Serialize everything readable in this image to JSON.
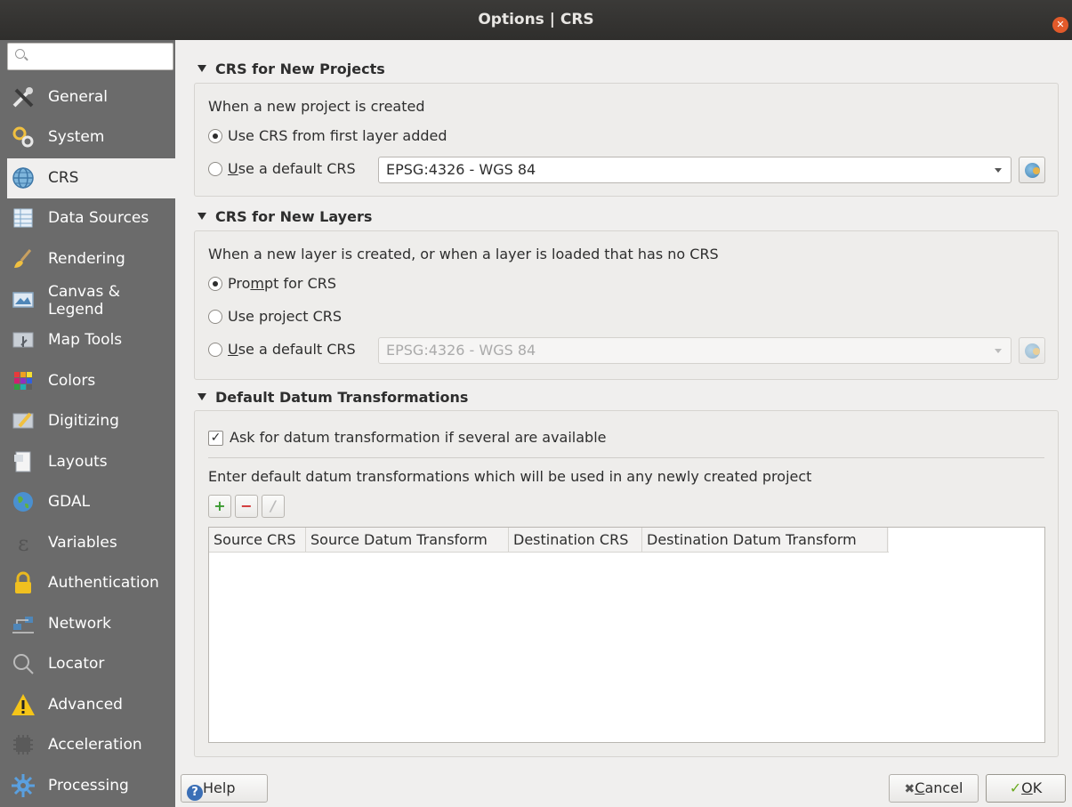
{
  "window": {
    "title": "Options | CRS",
    "close_glyph": "✕"
  },
  "sidebar": {
    "search_placeholder": "",
    "items": [
      {
        "label": "General",
        "icon": "tools-icon"
      },
      {
        "label": "System",
        "icon": "system-gears-icon"
      },
      {
        "label": "CRS",
        "icon": "globe-icon",
        "selected": true
      },
      {
        "label": "Data Sources",
        "icon": "table-icon"
      },
      {
        "label": "Rendering",
        "icon": "brush-icon"
      },
      {
        "label": "Canvas &",
        "label2": "Legend",
        "icon": "canvas-icon"
      },
      {
        "label": "Map Tools",
        "icon": "map-tools-icon"
      },
      {
        "label": "Colors",
        "icon": "colors-icon"
      },
      {
        "label": "Digitizing",
        "icon": "digitizing-icon"
      },
      {
        "label": "Layouts",
        "icon": "layouts-icon"
      },
      {
        "label": "GDAL",
        "icon": "gdal-globe-icon"
      },
      {
        "label": "Variables",
        "icon": "epsilon-icon"
      },
      {
        "label": "Authentication",
        "icon": "lock-icon"
      },
      {
        "label": "Network",
        "icon": "network-icon"
      },
      {
        "label": "Locator",
        "icon": "search-icon"
      },
      {
        "label": "Advanced",
        "icon": "warning-icon"
      },
      {
        "label": "Acceleration",
        "icon": "chip-icon"
      },
      {
        "label": "Processing",
        "icon": "processing-gear-icon"
      }
    ]
  },
  "projects": {
    "heading": "CRS for New Projects",
    "intro": "When a new project is created",
    "opt_first_layer": "Use CRS from first layer added",
    "opt_default_pre": "",
    "opt_default_u": "U",
    "opt_default_rest": "se a default CRS",
    "crs_value": "EPSG:4326 - WGS 84"
  },
  "layers": {
    "heading": "CRS for New Layers",
    "intro": "When a new layer is created, or when a layer is loaded that has no CRS",
    "opt_prompt_a": "Pro",
    "opt_prompt_u": "m",
    "opt_prompt_b": "pt for CRS",
    "opt_project": "Use project CRS",
    "opt_default_u": "U",
    "opt_default_rest": "se a default CRS",
    "crs_value": "EPSG:4326 - WGS 84"
  },
  "datum": {
    "heading": "Default Datum Transformations",
    "ask_label": "Ask for datum transformation if several are available",
    "check_glyph": "✓",
    "enter_text": "Enter default datum transformations which will be used in any newly created project",
    "add_glyph": "+",
    "remove_glyph": "−",
    "edit_glyph": "/",
    "columns": [
      "Source CRS",
      "Source Datum Transform",
      "Destination CRS",
      "Destination Datum Transform"
    ]
  },
  "footer": {
    "help_label": "Help",
    "help_glyph": "?",
    "cancel_glyph": "✖",
    "cancel_u": "C",
    "cancel_rest": "ancel",
    "ok_glyph": "✓",
    "ok_u": "O",
    "ok_rest": "K"
  }
}
